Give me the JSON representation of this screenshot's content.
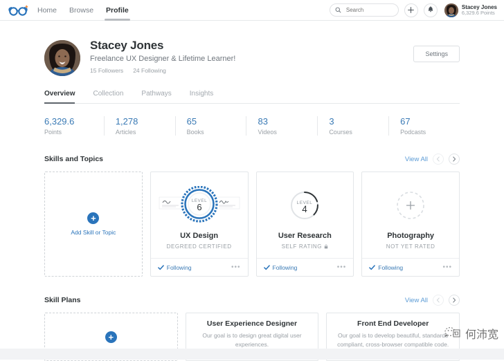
{
  "topnav": {
    "logo_icon": "degreed-glasses-logo",
    "links": [
      {
        "label": "Home",
        "active": false
      },
      {
        "label": "Browse",
        "active": false
      },
      {
        "label": "Profile",
        "active": true
      }
    ],
    "search": {
      "placeholder": "Search",
      "value": "",
      "icon": "search-icon"
    },
    "add_icon": "plus-icon",
    "notifications_icon": "bell-icon",
    "user": {
      "name": "Stacey Jones",
      "points": "6,329.6 Points",
      "avatar": "user-avatar"
    }
  },
  "profile": {
    "name": "Stacey Jones",
    "tagline": "Freelance UX Designer & Lifetime Learner!",
    "followers": "15 Followers",
    "following": "24 Following",
    "settings_label": "Settings"
  },
  "tabs": [
    {
      "label": "Overview",
      "active": true
    },
    {
      "label": "Collection",
      "active": false
    },
    {
      "label": "Pathways",
      "active": false
    },
    {
      "label": "Insights",
      "active": false
    }
  ],
  "stats": [
    {
      "value": "6,329.6",
      "label": "Points"
    },
    {
      "value": "1,278",
      "label": "Articles"
    },
    {
      "value": "65",
      "label": "Books"
    },
    {
      "value": "83",
      "label": "Videos"
    },
    {
      "value": "3",
      "label": "Courses"
    },
    {
      "value": "67",
      "label": "Podcasts"
    }
  ],
  "skills_section": {
    "title": "Skills and Topics",
    "view_all": "View All",
    "prev_icon": "chevron-left-icon",
    "next_icon": "chevron-right-icon",
    "add_card": {
      "label": "Add Skill or Topic",
      "icon": "plus-icon"
    },
    "cards": [
      {
        "title": "UX Design",
        "subtitle": "DEGREED CERTIFIED",
        "level_label": "LEVEL",
        "level_value": "6",
        "badge_type": "certified",
        "following_label": "Following",
        "menu_icon": "more-options-icon",
        "locked": false
      },
      {
        "title": "User Research",
        "subtitle": "SELF RATING",
        "level_label": "LEVEL",
        "level_value": "4",
        "badge_type": "self-rating",
        "following_label": "Following",
        "menu_icon": "more-options-icon",
        "locked": true
      },
      {
        "title": "Photography",
        "subtitle": "NOT YET RATED",
        "level_label": "",
        "level_value": "+",
        "badge_type": "unrated",
        "following_label": "Following",
        "menu_icon": "more-options-icon",
        "locked": false
      }
    ]
  },
  "plans_section": {
    "title": "Skill Plans",
    "view_all": "View All",
    "prev_icon": "chevron-left-icon",
    "next_icon": "chevron-right-icon",
    "add_card": {
      "icon": "plus-icon"
    },
    "cards": [
      {
        "title": "User Experience Designer",
        "desc": "Our goal is to design great digital user experiences."
      },
      {
        "title": "Front End Developer",
        "desc": "Our goal is to develop beautiful, standards compliant, cross-browser compatible code."
      }
    ]
  },
  "watermark": {
    "text": "何沛宽",
    "icon": "wechat-icon"
  },
  "colors": {
    "accent_blue": "#2a74bb",
    "link_blue": "#5b9bd5",
    "stat_blue": "#3a7ab5",
    "text_dark": "#2f3437",
    "text_muted": "#9aa0a6",
    "border": "#e3e6e9",
    "page_bg": "#f2f3f5"
  }
}
